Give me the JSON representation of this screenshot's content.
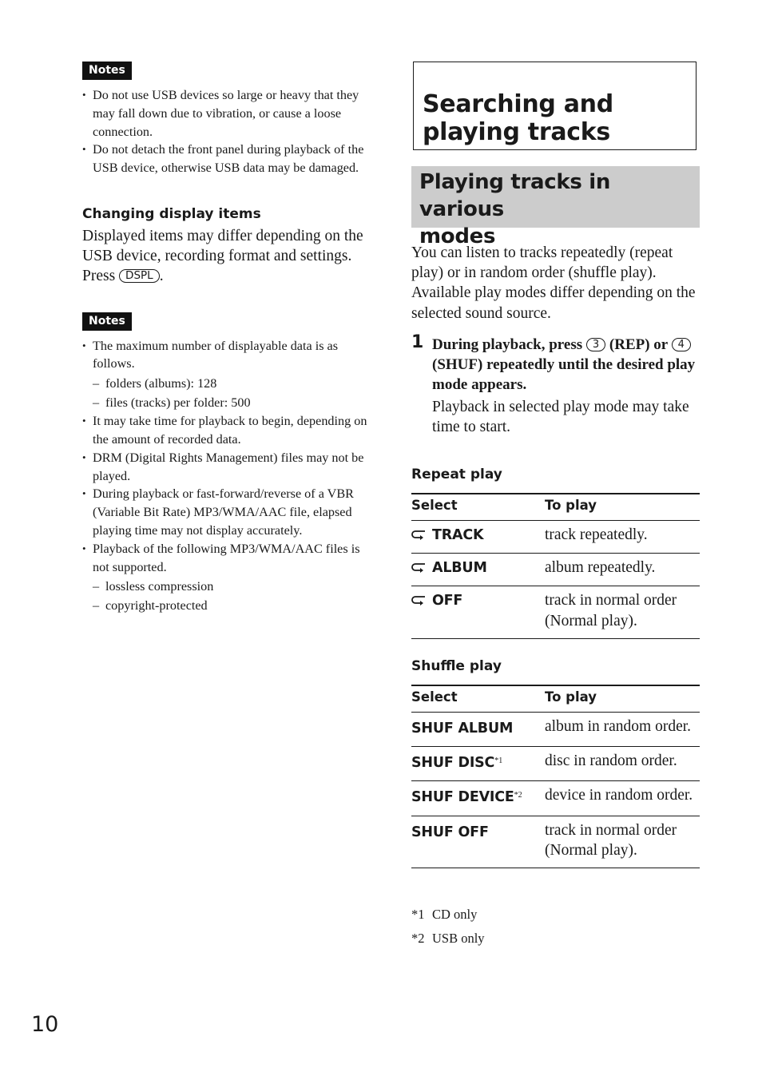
{
  "left": {
    "notes1": {
      "badge": "Notes",
      "items": [
        "Do not use USB devices so large or heavy that they may fall down due to vibration, or cause a loose connection.",
        "Do not detach the front panel during playback of the USB device, otherwise USB data may be damaged."
      ]
    },
    "display_items": {
      "heading": "Changing display items",
      "body": "Displayed items may differ depending on the USB device, recording format and settings.",
      "press_prefix": "Press",
      "key": "DSPL",
      "press_suffix": "."
    },
    "notes2": {
      "badge": "Notes",
      "items": [
        {
          "text": "The maximum number of displayable data is as follows.",
          "sub": [
            "folders (albums): 128",
            "files (tracks) per folder: 500"
          ]
        },
        {
          "text": "It may take time for playback to begin, depending on the amount of recorded data."
        },
        {
          "text": "DRM (Digital Rights Management) files may not be played."
        },
        {
          "text": "During playback or fast-forward/reverse of a VBR (Variable Bit Rate) MP3/WMA/AAC file, elapsed playing time may not display accurately."
        },
        {
          "text": "Playback of the following MP3/WMA/AAC files is not supported.",
          "sub": [
            "lossless compression",
            "copyright-protected"
          ]
        }
      ]
    }
  },
  "right": {
    "chapter_title_line1": "Searching and",
    "chapter_title_line2": "playing tracks",
    "section_title_line1": "Playing tracks in various",
    "section_title_line2": "modes",
    "intro": "You can listen to tracks repeatedly (repeat play) or in random order (shuffle play). Available play modes differ depending on the selected sound source.",
    "step": {
      "number": "1",
      "part1": "During playback, press",
      "key1": "3",
      "part2": "(REP) or",
      "key2": "4",
      "part3": "(SHUF) repeatedly until the desired play mode appears.",
      "note": "Playback in selected play mode may take time to start."
    },
    "repeat_table": {
      "heading": "Repeat play",
      "col_select": "Select",
      "col_play": "To play",
      "icon": "repeat-icon",
      "rows": [
        {
          "select": "TRACK",
          "play": "track repeatedly."
        },
        {
          "select": "ALBUM",
          "play": "album repeatedly."
        },
        {
          "select": "OFF",
          "play": "track in normal order (Normal play)."
        }
      ]
    },
    "shuffle_table": {
      "heading": "Shuffle play",
      "col_select": "Select",
      "col_play": "To play",
      "rows": [
        {
          "select": "SHUF ALBUM",
          "mark": "",
          "play": "album in random order."
        },
        {
          "select": "SHUF DISC",
          "mark": "*1",
          "play": "disc in random order."
        },
        {
          "select": "SHUF DEVICE",
          "mark": "*2",
          "play": "device in random order."
        },
        {
          "select": "SHUF OFF",
          "mark": "",
          "play": "track in normal order (Normal play)."
        }
      ]
    },
    "footnotes": [
      {
        "mark": "*1",
        "text": "CD only"
      },
      {
        "mark": "*2",
        "text": "USB only"
      }
    ]
  },
  "page_number": "10",
  "colors": {
    "text": "#1a1a1a",
    "badge_bg": "#111111",
    "section_bg": "#cccccc"
  }
}
